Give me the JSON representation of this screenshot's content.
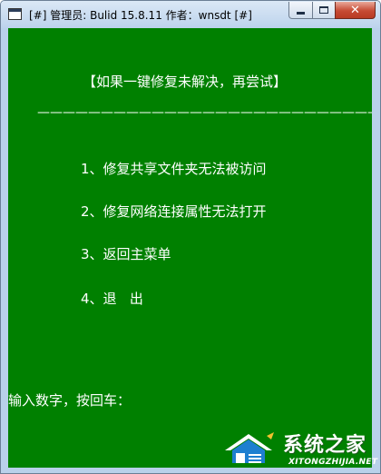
{
  "window": {
    "title": "[#] 管理员: Bulid 15.8.11   作者：wnsdt [#]"
  },
  "console": {
    "heading": "【如果一键修复未解决，再尝试】",
    "divider": "————————————————————————————————",
    "menu": [
      {
        "number": "1",
        "label": "1、修复共享文件夹无法被访问"
      },
      {
        "number": "2",
        "label": "2、修复网络连接属性无法打开"
      },
      {
        "number": "3",
        "label": "3、返回主菜单"
      },
      {
        "number": "4",
        "label": "4、退   出"
      }
    ],
    "prompt": "输入数字，按回车："
  },
  "watermark": {
    "brand": "系统之家",
    "url": "XITONGZHIJIA.NET"
  },
  "colors": {
    "console_bg": "#008000",
    "console_fg": "#ffffff",
    "frame": "#b9d1ea",
    "close_button": "#c64a33"
  },
  "icons": {
    "app": "console-window-icon",
    "minimize": "minimize-icon",
    "maximize": "maximize-icon",
    "close": "close-icon"
  }
}
